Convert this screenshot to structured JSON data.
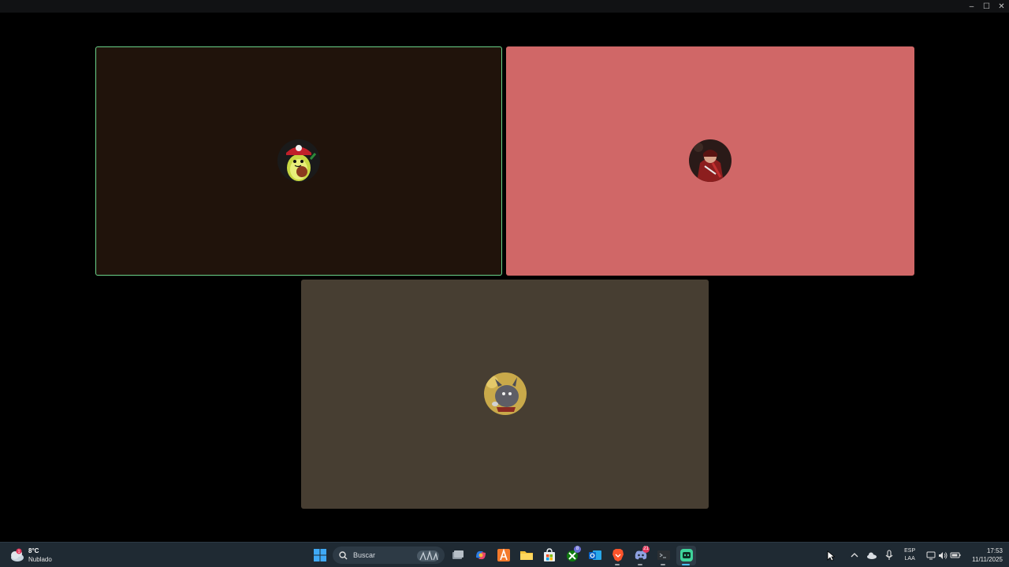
{
  "window": {
    "minimize_glyph": "–",
    "maximize_glyph": "☐",
    "close_glyph": "✕"
  },
  "participants": [
    {
      "name": "",
      "avatar": "avocado-character-avatar",
      "tile_color": "#20130b",
      "speaking": true
    },
    {
      "name": "",
      "avatar": "red-warrior-avatar",
      "tile_color": "#d06767",
      "speaking": false
    },
    {
      "name": "",
      "avatar": "gray-creature-avatar",
      "tile_color": "#473e32",
      "speaking": false
    }
  ],
  "taskbar": {
    "weather": {
      "temperature": "8°C",
      "condition": "Nublado",
      "alert_count": "1"
    },
    "search": {
      "placeholder": "Buscar"
    },
    "pinned_apps": [
      {
        "name": "start-icon"
      },
      {
        "name": "task-view-icon"
      },
      {
        "name": "copilot-icon"
      },
      {
        "name": "app-a-icon"
      },
      {
        "name": "file-explorer-icon"
      },
      {
        "name": "store-icon"
      },
      {
        "name": "xbox-icon",
        "badge": "8"
      },
      {
        "name": "outlook-icon"
      },
      {
        "name": "brave-icon"
      },
      {
        "name": "discord-icon",
        "badge": "21"
      },
      {
        "name": "terminal-icon"
      },
      {
        "name": "active-app-icon"
      }
    ],
    "language": {
      "line1": "ESP",
      "line2": "LAA"
    },
    "clock": {
      "time": "17:53",
      "date": "11/11/2025"
    }
  },
  "colors": {
    "speaking_border": "#6bd38a",
    "taskbar_bg": "#1f2a33"
  }
}
